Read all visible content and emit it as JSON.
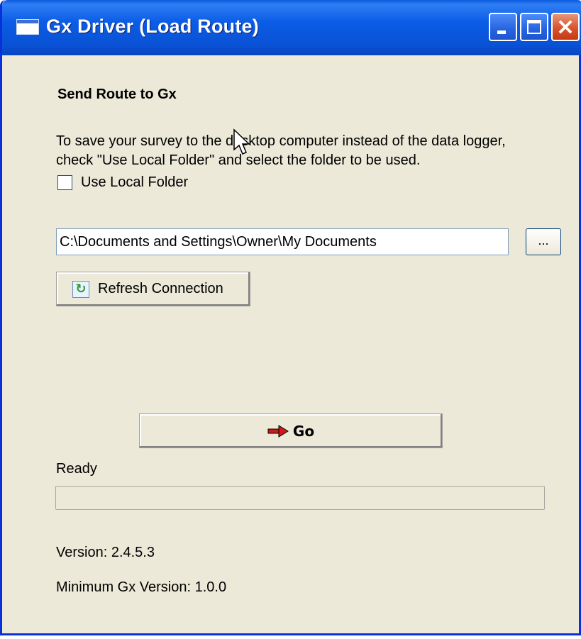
{
  "window": {
    "title": "Gx Driver (Load Route)"
  },
  "content": {
    "heading": "Send Route to Gx",
    "description": "To save your survey to the desktop computer instead of the data logger, check \"Use Local Folder\" and select the folder to be used.",
    "use_local_folder_label": "Use Local Folder",
    "use_local_folder_checked": false,
    "folder_path": "C:\\Documents and Settings\\Owner\\My Documents",
    "browse_label": "...",
    "refresh_label": "Refresh Connection",
    "go_label": "Go",
    "status": "Ready",
    "progress": 0,
    "version": "Version: 2.4.5.3",
    "min_version": "Minimum Gx Version: 1.0.0"
  },
  "icons": {
    "app": "window-icon",
    "refresh": "refresh-icon",
    "go": "red-arrow-icon"
  },
  "colors": {
    "titlebar": "#0a52d6",
    "window_bg": "#ece9d8",
    "close_button": "#d9532c"
  }
}
